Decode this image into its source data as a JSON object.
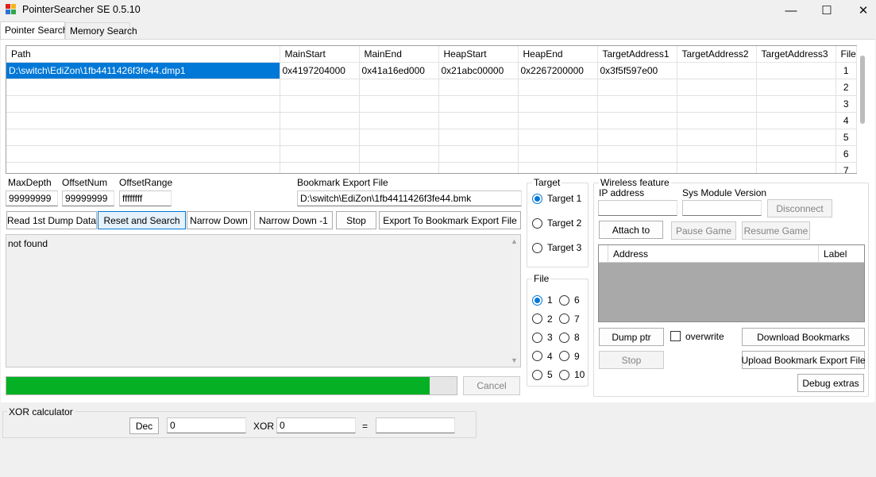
{
  "window": {
    "title": "PointerSearcher SE 0.5.10",
    "minimize": "—",
    "maximize": "☐",
    "close": "✕"
  },
  "tabs": [
    {
      "label": "Pointer Search"
    },
    {
      "label": "Memory Search"
    }
  ],
  "grid": {
    "columns": [
      "Path",
      "MainStart",
      "MainEnd",
      "HeapStart",
      "HeapEnd",
      "TargetAddress1",
      "TargetAddress2",
      "TargetAddress3",
      "File"
    ],
    "rows": [
      [
        "D:\\switch\\EdiZon\\1fb4411426f3fe44.dmp1",
        "0x4197204000",
        "0x41a16ed000",
        "0x21abc00000",
        "0x2267200000",
        "0x3f5f597e00",
        "",
        "",
        "1"
      ],
      [
        "",
        "",
        "",
        "",
        "",
        "",
        "",
        "",
        "2"
      ],
      [
        "",
        "",
        "",
        "",
        "",
        "",
        "",
        "",
        "3"
      ],
      [
        "",
        "",
        "",
        "",
        "",
        "",
        "",
        "",
        "4"
      ],
      [
        "",
        "",
        "",
        "",
        "",
        "",
        "",
        "",
        "5"
      ],
      [
        "",
        "",
        "",
        "",
        "",
        "",
        "",
        "",
        "6"
      ],
      [
        "",
        "",
        "",
        "",
        "",
        "",
        "",
        "",
        "7"
      ]
    ]
  },
  "search": {
    "max_depth_label": "MaxDepth",
    "max_depth": "99999999",
    "offset_num_label": "OffsetNum",
    "offset_num": "99999999",
    "offset_range_label": "OffsetRange",
    "offset_range": "ffffffff",
    "bookmark_label": "Bookmark Export File",
    "bookmark_path": "D:\\switch\\EdiZon\\1fb4411426f3fe44.bmk"
  },
  "buttons": {
    "read_dump": "Read 1st Dump Data",
    "reset_search": "Reset and Search",
    "narrow_down": "Narrow Down",
    "narrow_down_minus": "Narrow Down -1",
    "stop": "Stop",
    "export_bookmark": "Export To Bookmark Export File",
    "cancel": "Cancel"
  },
  "output": {
    "text": "not found"
  },
  "progress": {
    "value": 0.94
  },
  "target": {
    "title": "Target",
    "options": [
      "Target 1",
      "Target 2",
      "Target 3"
    ],
    "selected": "Target 1"
  },
  "file": {
    "title": "File",
    "options": [
      "1",
      "2",
      "3",
      "4",
      "5",
      "6",
      "7",
      "8",
      "9",
      "10"
    ],
    "selected": "1"
  },
  "wireless": {
    "title": "Wireless feature",
    "ip_label": "IP address",
    "sysmod_label": "Sys Module Version",
    "disconnect": "Disconnect",
    "attach": "Attach to",
    "pause": "Pause Game",
    "resume": "Resume Game",
    "table_headers": [
      "Address",
      "Label"
    ],
    "dump_ptr": "Dump ptr",
    "overwrite": "overwrite",
    "download_bookmarks": "Download Bookmarks",
    "stop": "Stop",
    "upload_bookmark": "Upload Bookmark Export File",
    "debug_extras": "Debug extras"
  },
  "xor": {
    "title": "XOR calculator",
    "mode_button": "Dec",
    "a": "0",
    "op": "XOR",
    "b": "0",
    "eq": "=",
    "result": ""
  },
  "colors": {
    "accent": "#0078d7",
    "progress": "#06b025"
  }
}
